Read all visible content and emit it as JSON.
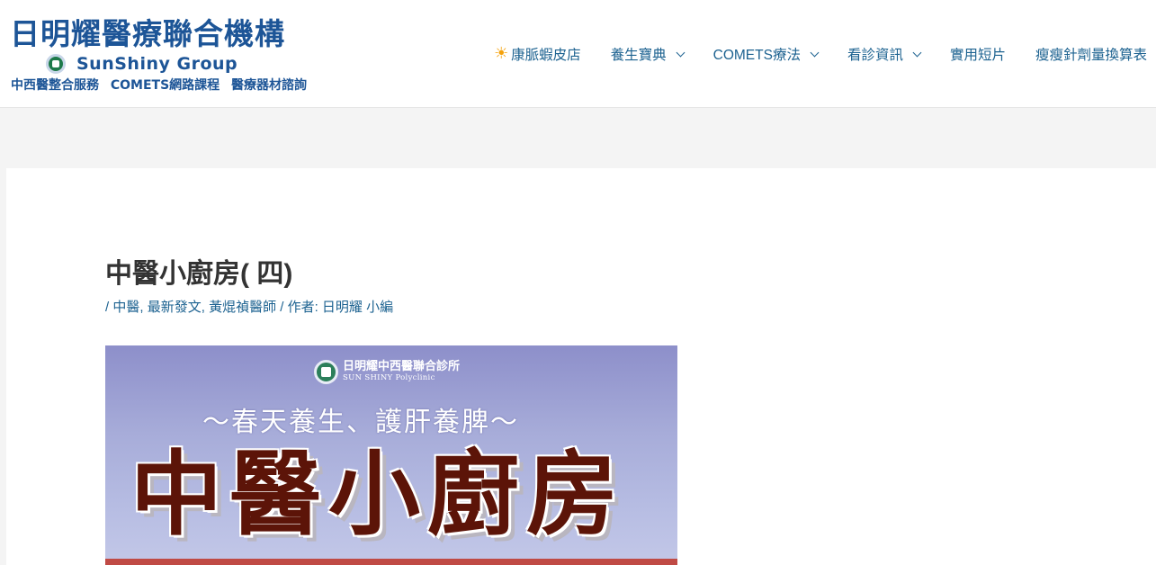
{
  "logo": {
    "title": "日明耀醫療聯合機構",
    "group": "SunShiny Group",
    "subtitle": "中西醫整合服務 COMETS網路課程 醫療器材諮詢"
  },
  "nav": [
    {
      "label": "康脈蝦皮店",
      "icon": "sun-icon",
      "has_dropdown": false
    },
    {
      "label": "養生寶典",
      "has_dropdown": true
    },
    {
      "label": "COMETS療法",
      "has_dropdown": true
    },
    {
      "label": "看診資訊",
      "has_dropdown": true
    },
    {
      "label": "實用短片",
      "has_dropdown": false
    },
    {
      "label": "瘦瘦針劑量換算表",
      "has_dropdown": false
    }
  ],
  "post": {
    "title": "中醫小廚房( 四)",
    "meta_prefix": "/ ",
    "categories": [
      "中醫",
      "最新發文",
      "黃焜禎醫師"
    ],
    "author_prefix": " / 作者: ",
    "author": "日明耀 小編"
  },
  "banner": {
    "clinic_name": "日明耀中西醫聯合診所",
    "clinic_en": "SUN SHINY Polyclinic",
    "subtitle": "～春天養生、護肝養脾～",
    "title": "中醫小廚房"
  },
  "colors": {
    "brand_blue": "#1d5597",
    "link": "#1e6391",
    "banner_title": "#5c1408"
  }
}
